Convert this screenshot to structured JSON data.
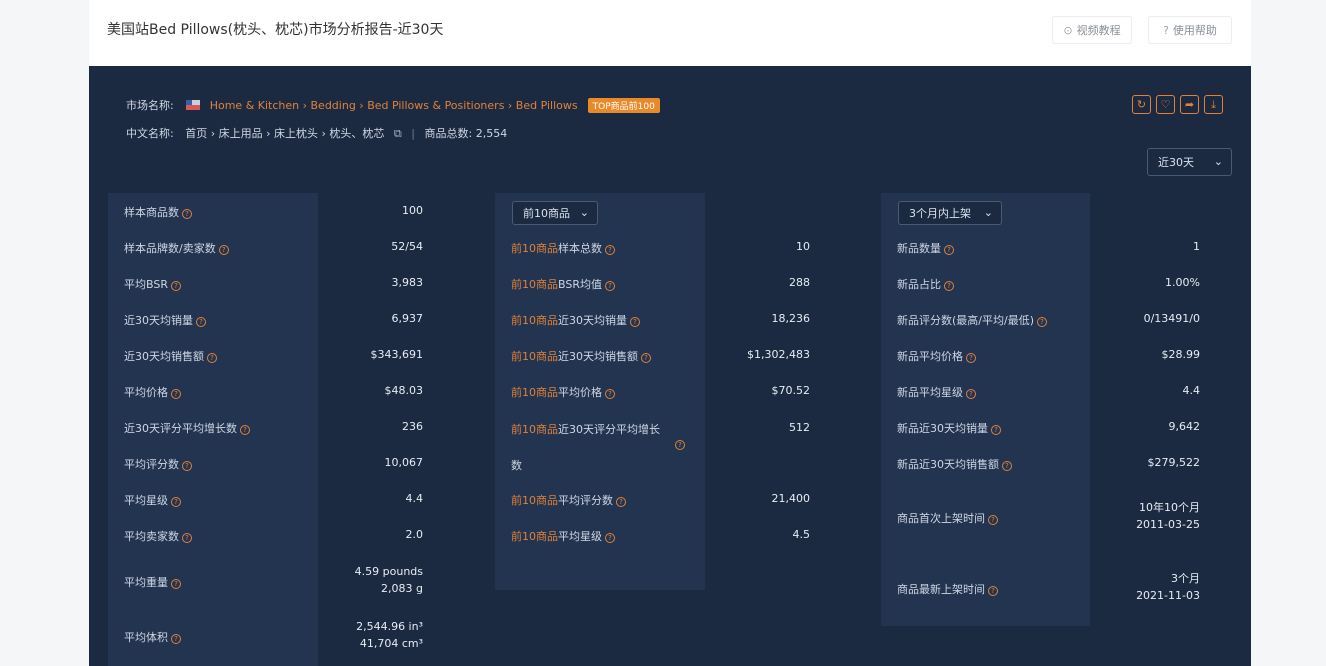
{
  "header": {
    "title": "美国站Bed Pillows(枕头、枕芯)市场分析报告-近30天",
    "video_tutorial": "视频教程",
    "help": "使用帮助"
  },
  "market": {
    "label": "市场名称:",
    "breadcrumb": "Home & Kitchen › Bedding › Bed Pillows & Positioners › Bed Pillows",
    "badge": "TOP商品前100",
    "cn_label": "中文名称:",
    "cn_path": "首页 › 床上用品 › 床上枕头 › 枕头、枕芯",
    "total_label": "商品总数:",
    "total_value": "2,554"
  },
  "range_select": "近30天",
  "col1": {
    "rows": [
      {
        "k": "样本商品数",
        "v": "100"
      },
      {
        "k": "样本品牌数/卖家数",
        "v": "52/54"
      },
      {
        "k": "平均BSR",
        "v": "3,983"
      },
      {
        "k": "近30天均销量",
        "v": "6,937"
      },
      {
        "k": "近30天均销售额",
        "v": "$343,691"
      },
      {
        "k": "平均价格",
        "v": "$48.03"
      },
      {
        "k": "近30天评分平均增长数",
        "v": "236"
      },
      {
        "k": "平均评分数",
        "v": "10,067"
      },
      {
        "k": "平均星级",
        "v": "4.4"
      },
      {
        "k": "平均卖家数",
        "v": "2.0"
      }
    ],
    "weight": {
      "k": "平均重量",
      "v1": "4.59 pounds",
      "v2": "2,083 g"
    },
    "volume": {
      "k": "平均体积",
      "v1": "2,544.96 in³",
      "v2": "41,704 cm³"
    }
  },
  "col2": {
    "select": "前10商品",
    "prefix": "前10商品",
    "rows": [
      {
        "k": "样本总数",
        "v": "10"
      },
      {
        "k": "BSR均值",
        "v": "288"
      },
      {
        "k": "近30天均销量",
        "v": "18,236"
      },
      {
        "k": "近30天均销售额",
        "v": "$1,302,483"
      },
      {
        "k": "平均价格",
        "v": "$70.52"
      }
    ],
    "growth": {
      "k1": "近30天评分平均增长",
      "k2": "数",
      "v": "512"
    },
    "rows2": [
      {
        "k": "平均评分数",
        "v": "21,400"
      },
      {
        "k": "平均星级",
        "v": "4.5"
      }
    ]
  },
  "col3": {
    "select": "3个月内上架",
    "rows": [
      {
        "k": "新品数量",
        "v": "1"
      },
      {
        "k": "新品占比",
        "v": "1.00%"
      },
      {
        "k": "新品评分数(最高/平均/最低)",
        "v": "0/13491/0"
      },
      {
        "k": "新品平均价格",
        "v": "$28.99"
      },
      {
        "k": "新品平均星级",
        "v": "4.4"
      },
      {
        "k": "新品近30天均销量",
        "v": "9,642"
      },
      {
        "k": "新品近30天均销售额",
        "v": "$279,522"
      }
    ],
    "first_listed": {
      "k": "商品首次上架时间",
      "v1": "10年10个月",
      "v2": "2011-03-25"
    },
    "latest_listed": {
      "k": "商品最新上架时间",
      "v1": "3个月",
      "v2": "2021-11-03"
    }
  }
}
